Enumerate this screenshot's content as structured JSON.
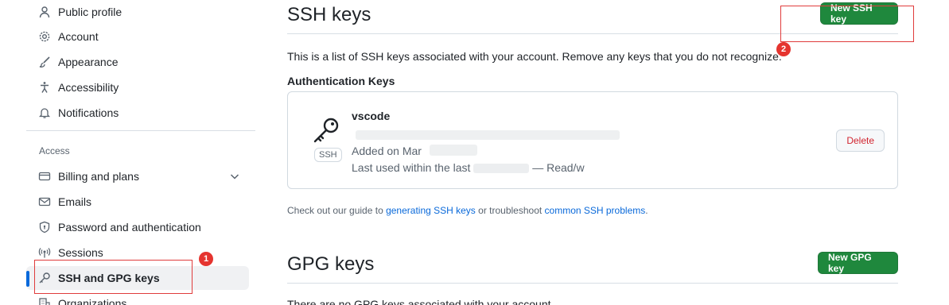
{
  "sidebar": {
    "items_top": [
      {
        "label": "Public profile",
        "icon": "person-icon"
      },
      {
        "label": "Account",
        "icon": "gear-icon"
      },
      {
        "label": "Appearance",
        "icon": "paintbrush-icon"
      },
      {
        "label": "Accessibility",
        "icon": "accessibility-icon"
      },
      {
        "label": "Notifications",
        "icon": "bell-icon"
      }
    ],
    "access_heading": "Access",
    "items_access": [
      {
        "label": "Billing and plans",
        "icon": "credit-card-icon"
      },
      {
        "label": "Emails",
        "icon": "mail-icon"
      },
      {
        "label": "Password and authentication",
        "icon": "shield-lock-icon"
      },
      {
        "label": "Sessions",
        "icon": "broadcast-icon"
      },
      {
        "label": "SSH and GPG keys",
        "icon": "key-icon",
        "active": true
      },
      {
        "label": "Organizations",
        "icon": "organization-icon"
      }
    ]
  },
  "ssh": {
    "title": "SSH keys",
    "new_button": "New SSH key",
    "description": "This is a list of SSH keys associated with your account. Remove any keys that you do not recognize.",
    "auth_heading": "Authentication Keys",
    "key": {
      "badge": "SSH",
      "title": "vscode",
      "added": "Added on Mar",
      "last_used_prefix": "Last used within the last",
      "last_used_suffix": "— Read/w",
      "delete_button": "Delete"
    },
    "guide_prefix": "Check out our guide to ",
    "guide_link1": "generating SSH keys",
    "guide_middle": " or troubleshoot ",
    "guide_link2": "common SSH problems",
    "guide_suffix": "."
  },
  "gpg": {
    "title": "GPG keys",
    "new_button": "New GPG key",
    "empty_text": "There are no GPG keys associated with your account."
  },
  "annotations": [
    "1",
    "2"
  ],
  "colors": {
    "primary_green": "#1f883d",
    "link_blue": "#0969da",
    "danger_red": "#d1242f",
    "annotation_red": "#e5342f"
  }
}
